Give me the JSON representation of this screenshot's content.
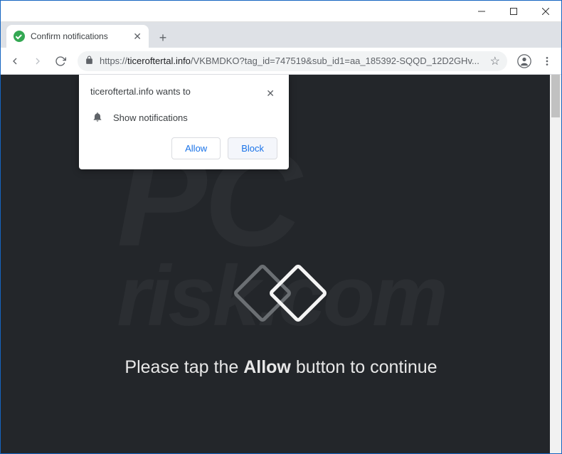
{
  "tab": {
    "title": "Confirm notifications"
  },
  "url": {
    "scheme": "https://",
    "host": "ticeroftertal.info",
    "path": "/VKBMDKO?tag_id=747519&sub_id1=aa_185392-SQQD_12D2GHv..."
  },
  "prompt": {
    "origin_line": "ticeroftertal.info wants to",
    "permission_label": "Show notifications",
    "allow": "Allow",
    "block": "Block"
  },
  "page": {
    "msg_prefix": "Please tap the ",
    "msg_bold": "Allow",
    "msg_suffix": " button to continue"
  },
  "watermark": {
    "top": "PC",
    "bottom": "risk.com"
  }
}
